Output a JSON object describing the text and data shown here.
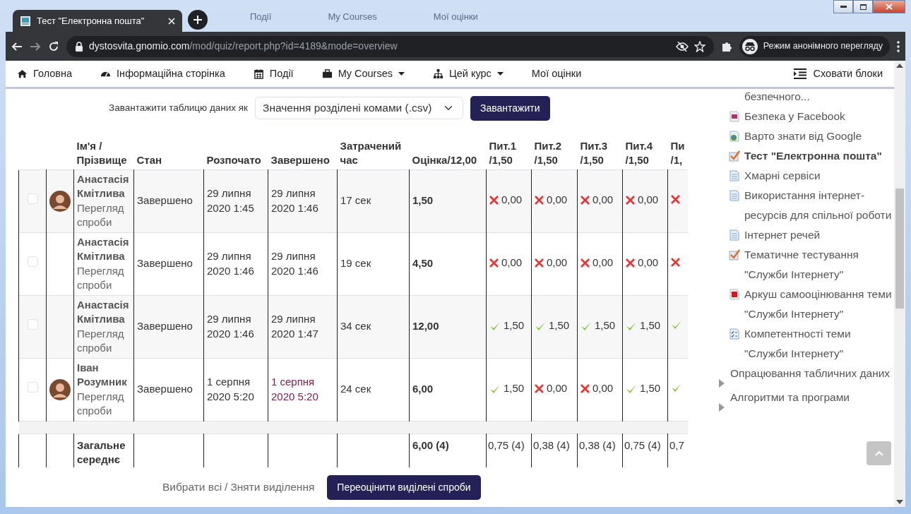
{
  "browser": {
    "tab_title": "Тест \"Електронна пошта\"",
    "background_tabs": [
      "Події",
      "My Courses",
      "Мої оцінки"
    ],
    "url_domain": "dystosvita.gnomio.com",
    "url_path": "/mod/quiz/report.php?id=4189&mode=overview",
    "incognito_label": "Режим анонімного перегляду"
  },
  "navbar": {
    "items": [
      {
        "label": "Головна",
        "dropdown": false
      },
      {
        "label": "Інформаційна сторінка",
        "dropdown": false
      },
      {
        "label": "Події",
        "dropdown": false
      },
      {
        "label": "My Courses",
        "dropdown": true
      },
      {
        "label": "Цей курс",
        "dropdown": true
      },
      {
        "label": "Мої оцінки",
        "dropdown": false
      }
    ],
    "hide_blocks": "Сховати блоки"
  },
  "download": {
    "label": "Завантажити таблицю даних як",
    "format": "Значення розділені комами (.csv)",
    "button": "Завантажити"
  },
  "table": {
    "columns": [
      "Ім'я / Прізвище",
      "Стан",
      "Розпочато",
      "Завершено",
      "Затрачений час",
      "Оцінка/12,00",
      "Пит.1 /1,50",
      "Пит.2 /1,50",
      "Пит.3 /1,50",
      "Пит.4 /1,50",
      "Пи /1,"
    ],
    "rows": [
      {
        "selected": false,
        "avatar": true,
        "name": "Анастасія Кмітлива",
        "review_link": "Перегляд спроби",
        "state": "Завершено",
        "started": "29 липня 2020 1:45",
        "finished": "29 липня 2020 1:46",
        "finished_linked": false,
        "time": "17 сек",
        "grade": "1,50",
        "marks": [
          {
            "correct": false,
            "value": "0,00"
          },
          {
            "correct": false,
            "value": "0,00"
          },
          {
            "correct": false,
            "value": "0,00"
          },
          {
            "correct": false,
            "value": "0,00"
          },
          {
            "correct": false
          }
        ]
      },
      {
        "selected": false,
        "avatar": false,
        "name": "Анастасія Кмітлива",
        "review_link": "Перегляд спроби",
        "state": "Завершено",
        "started": "29 липня 2020 1:46",
        "finished": "29 липня 2020 1:46",
        "finished_linked": false,
        "time": "19 сек",
        "grade": "4,50",
        "marks": [
          {
            "correct": false,
            "value": "0,00"
          },
          {
            "correct": false,
            "value": "0,00"
          },
          {
            "correct": false,
            "value": "0,00"
          },
          {
            "correct": false,
            "value": "0,00"
          },
          {
            "correct": false
          }
        ]
      },
      {
        "selected": false,
        "avatar": false,
        "name": "Анастасія Кмітлива",
        "review_link": "Перегляд спроби",
        "state": "Завершено",
        "started": "29 липня 2020 1:46",
        "finished": "29 липня 2020 1:47",
        "finished_linked": false,
        "time": "34 сек",
        "grade": "12,00",
        "marks": [
          {
            "correct": true,
            "value": "1,50"
          },
          {
            "correct": true,
            "value": "1,50"
          },
          {
            "correct": true,
            "value": "1,50"
          },
          {
            "correct": true,
            "value": "1,50"
          },
          {
            "correct": true
          }
        ]
      },
      {
        "selected": false,
        "avatar": true,
        "name": "Іван Розумник",
        "review_link": "Перегляд спроби",
        "state": "Завершено",
        "started": "1 серпня 2020 5:20",
        "finished": "1 серпня 2020 5:20",
        "finished_linked": true,
        "time": "24 сек",
        "grade": "6,00",
        "marks": [
          {
            "correct": true,
            "value": "1,50"
          },
          {
            "correct": false,
            "value": "0,00"
          },
          {
            "correct": false,
            "value": "0,00"
          },
          {
            "correct": true,
            "value": "1,50"
          },
          {
            "correct": true
          }
        ]
      }
    ],
    "summary": {
      "label": "Загальне середнє",
      "grade": "6,00 (4)",
      "marks": [
        "0,75 (4)",
        "0,38 (4)",
        "0,38 (4)",
        "0,75 (4)",
        "0,7"
      ]
    }
  },
  "footer": {
    "select_all": "Вибрати всі",
    "separator": "/",
    "deselect_all": "Зняти виділення",
    "button": "Переоцінити виділені спроби"
  },
  "sidebar": {
    "items": [
      {
        "kind": "text",
        "label": "безпечного...",
        "current": false
      },
      {
        "kind": "feedback",
        "label": "Безпека у Facebook",
        "current": false
      },
      {
        "kind": "url",
        "label": "Варто знати від Google",
        "current": false
      },
      {
        "kind": "quiz",
        "label": "Тест \"Електронна пошта\"",
        "current": true
      },
      {
        "kind": "page",
        "label": "Хмарні сервіси",
        "current": false
      },
      {
        "kind": "page",
        "label": "Використання інтернет-ресурсів для спільної роботи",
        "current": false
      },
      {
        "kind": "page",
        "label": "Інтернет речей",
        "current": false
      },
      {
        "kind": "quiz",
        "label": "Тематичне тестування \"Служби Інтернету\"",
        "current": false
      },
      {
        "kind": "pdf",
        "label": "Аркуш самооцінювання теми \"Служби Інтернету\"",
        "current": false
      },
      {
        "kind": "checklist",
        "label": "Компетентності теми \"Служби Інтернету\"",
        "current": false
      },
      {
        "kind": "section",
        "label": "Опрацювання табличних даних",
        "current": false
      },
      {
        "kind": "section",
        "label": "Алгоритми та програми",
        "current": false
      }
    ]
  }
}
